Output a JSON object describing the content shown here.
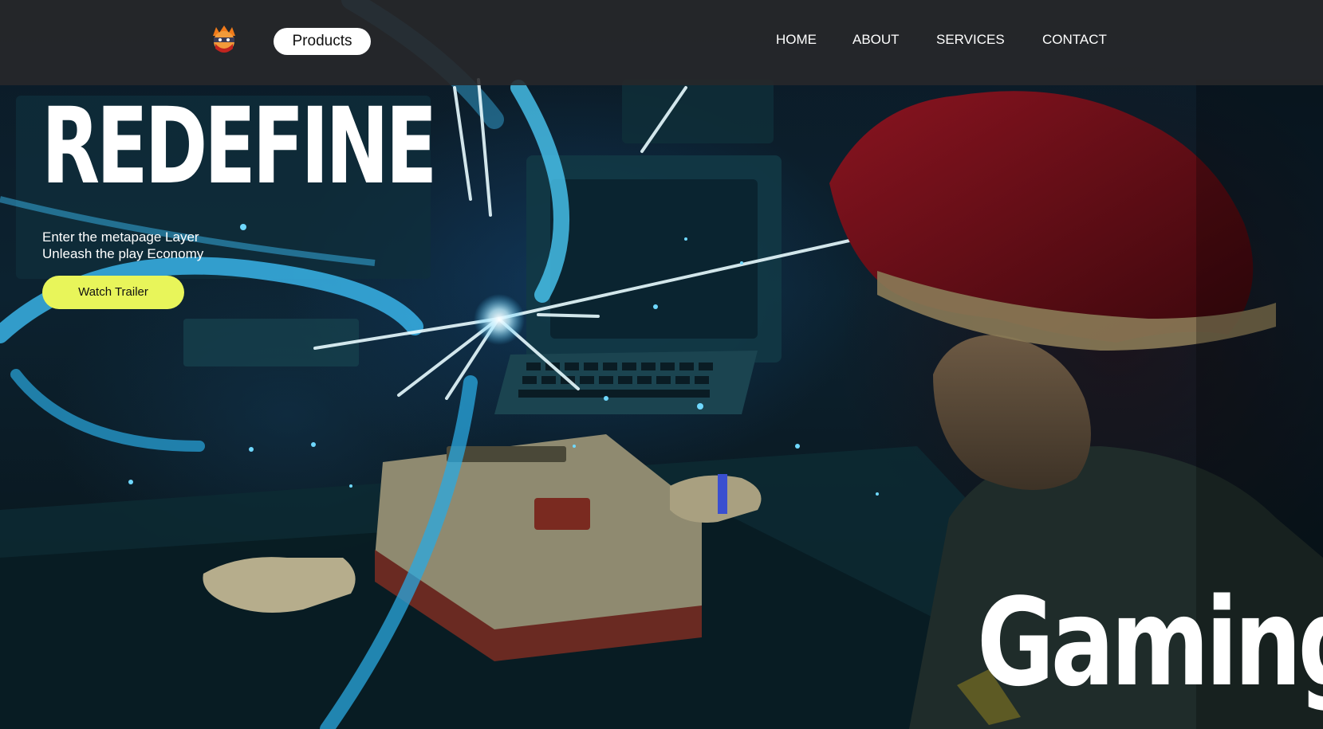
{
  "nav": {
    "logo_icon": "ninja-mascot-icon",
    "products_label": "Products",
    "links": [
      "HOME",
      "ABOUT",
      "SERVICES",
      "CONTACT"
    ]
  },
  "hero": {
    "title": "REDEFINE",
    "tagline_line1": "Enter the metapage Layer",
    "tagline_line2": "Unleash the play Economy",
    "cta_label": "Watch Trailer",
    "bottom_word": "Gaming"
  },
  "colors": {
    "accent": "#e8f55a",
    "nav_bg": "#28282a",
    "text": "#ffffff",
    "glow": "#3fc6ff"
  }
}
